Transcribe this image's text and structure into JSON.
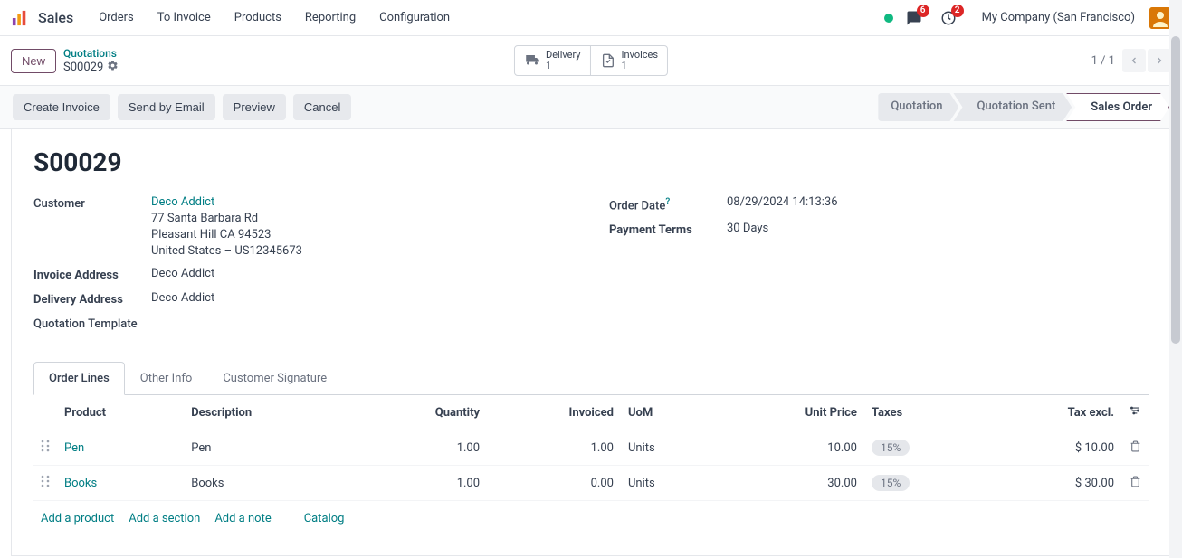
{
  "topnav": {
    "app": "Sales",
    "items": [
      "Orders",
      "To Invoice",
      "Products",
      "Reporting",
      "Configuration"
    ],
    "chat_badge": "6",
    "activity_badge": "2",
    "company": "My Company (San Francisco)"
  },
  "controlbar": {
    "new": "New",
    "breadcrumb_top": "Quotations",
    "breadcrumb_current": "S00029",
    "stats": [
      {
        "label": "Delivery",
        "value": "1"
      },
      {
        "label": "Invoices",
        "value": "1"
      }
    ],
    "pager": "1 / 1"
  },
  "actions": {
    "buttons": [
      "Create Invoice",
      "Send by Email",
      "Preview",
      "Cancel"
    ],
    "stages": [
      "Quotation",
      "Quotation Sent",
      "Sales Order"
    ],
    "active_stage": 2
  },
  "record": {
    "title": "S00029",
    "customer_label": "Customer",
    "customer_name": "Deco Addict",
    "customer_addr": [
      "77 Santa Barbara Rd",
      "Pleasant Hill CA 94523",
      "United States – US12345673"
    ],
    "invoice_addr_label": "Invoice Address",
    "invoice_addr": "Deco Addict",
    "delivery_addr_label": "Delivery Address",
    "delivery_addr": "Deco Addict",
    "quote_tpl_label": "Quotation Template",
    "order_date_label": "Order Date",
    "order_date": "08/29/2024 14:13:36",
    "payment_terms_label": "Payment Terms",
    "payment_terms": "30 Days"
  },
  "tabs": [
    "Order Lines",
    "Other Info",
    "Customer Signature"
  ],
  "active_tab": 0,
  "table": {
    "headers": {
      "product": "Product",
      "description": "Description",
      "quantity": "Quantity",
      "invoiced": "Invoiced",
      "uom": "UoM",
      "unit_price": "Unit Price",
      "taxes": "Taxes",
      "tax_excl": "Tax excl."
    },
    "rows": [
      {
        "product": "Pen",
        "description": "Pen",
        "quantity": "1.00",
        "invoiced": "1.00",
        "uom": "Units",
        "unit_price": "10.00",
        "tax": "15%",
        "tax_excl": "$ 10.00"
      },
      {
        "product": "Books",
        "description": "Books",
        "quantity": "1.00",
        "invoiced": "0.00",
        "uom": "Units",
        "unit_price": "30.00",
        "tax": "15%",
        "tax_excl": "$ 30.00"
      }
    ],
    "add": {
      "product": "Add a product",
      "section": "Add a section",
      "note": "Add a note",
      "catalog": "Catalog"
    }
  }
}
